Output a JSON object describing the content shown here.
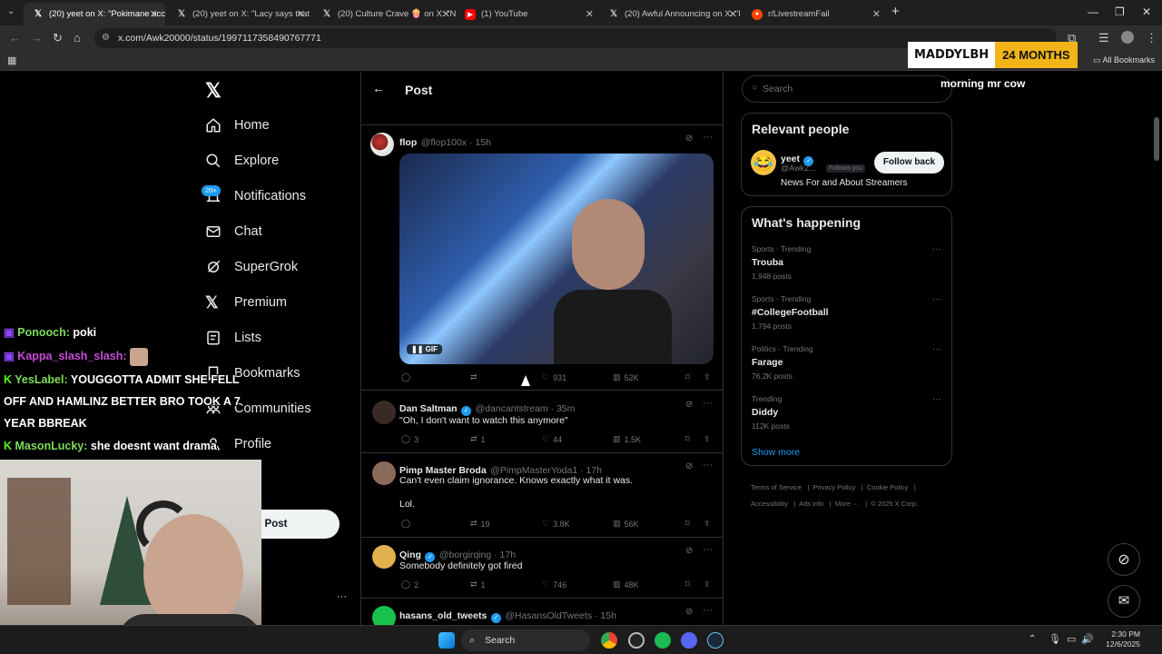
{
  "browser": {
    "tabs": [
      {
        "label": "(20) yeet on X: \"Pokimane acci",
        "icon": "x-logo"
      },
      {
        "label": "(20) yeet on X: \"Lacy says that I",
        "icon": "x-logo"
      },
      {
        "label": "(20) Culture Crave 🍿 on X: \"N",
        "icon": "x-logo"
      },
      {
        "label": "(1) YouTube",
        "icon": "youtube-icon"
      },
      {
        "label": "(20) Awful Announcing on X: \"I",
        "icon": "x-logo"
      },
      {
        "label": "r/LivestreamFail",
        "icon": "reddit-icon"
      }
    ],
    "url": "x.com/Awk20000/status/1997117358490767771",
    "all_bookmarks": "All Bookmarks"
  },
  "sub_badge": {
    "name": "MADDYLBH",
    "months": "24 MONTHS"
  },
  "stream_message": "morning mr cow",
  "nav": {
    "logo": "X",
    "notif_badge": "20+",
    "items": [
      "Home",
      "Explore",
      "Notifications",
      "Chat",
      "SuperGrok",
      "Premium",
      "Lists",
      "Bookmarks",
      "Communities",
      "Profile"
    ],
    "post_button": "Post"
  },
  "header": {
    "title": "Post"
  },
  "tweets": [
    {
      "name": "flop",
      "handle": "@flop100x · 15h",
      "gif_label": "GIF",
      "replies": "",
      "retweets": "",
      "likes": "931",
      "views": "52K"
    },
    {
      "name": "Dan Saltman",
      "handle": "@dancantstream · 35m",
      "text": "\"Oh, I don't want to watch this anymore\"",
      "replies": "3",
      "retweets": "1",
      "likes": "44",
      "views": "1.5K"
    },
    {
      "name": "Pimp Master Broda",
      "handle": "@PimpMasterYoda1 · 17h",
      "text": "Can't even claim ignorance. Knows exactly what it was.",
      "text2": "Lol.",
      "replies": "",
      "retweets": "19",
      "likes": "3.8K",
      "views": "56K"
    },
    {
      "name": "Qing",
      "handle": "@borgirqing · 17h",
      "text": "Somebody definitely got fired",
      "replies": "2",
      "retweets": "1",
      "likes": "746",
      "views": "48K"
    },
    {
      "name": "hasans_old_tweets",
      "handle": "@HasansOldTweets · 15h"
    }
  ],
  "search": {
    "placeholder": "Search"
  },
  "relevant": {
    "title": "Relevant people",
    "name": "yeet",
    "handle": "@Awk2...",
    "follows_you": "Follows you",
    "follow_back": "Follow back",
    "bio": "News For and About Streamers"
  },
  "happening": {
    "title": "What's happening",
    "trends": [
      {
        "category": "Sports · Trending",
        "name": "Trouba",
        "posts": "1,948 posts"
      },
      {
        "category": "Sports · Trending",
        "name": "#CollegeFootball",
        "posts": "1,794 posts"
      },
      {
        "category": "Politics · Trending",
        "name": "Farage",
        "posts": "76.2K posts"
      },
      {
        "category": "Trending",
        "name": "Diddy",
        "posts": "112K posts"
      }
    ],
    "show_more": "Show more"
  },
  "footer": {
    "terms": "Terms of Service",
    "privacy": "Privacy Policy",
    "cookie": "Cookie Policy",
    "accessibility": "Accessibility",
    "ads": "Ads info",
    "more": "More ···",
    "copyright": "© 2025 X Corp."
  },
  "chat": [
    {
      "user": "Ponooch:",
      "msg": "poki",
      "color": "#7ddc5a"
    },
    {
      "user": "Kappa_slash_slash:",
      "msg": "",
      "color": "#c84dd8"
    },
    {
      "user": "YesLabel:",
      "msg": "YOUGGOTTA ADMIT SHE FELL",
      "color": "#7ddc5a"
    },
    {
      "line": "OFF AND HAMLINZ BETTER BRO TOOK A 7"
    },
    {
      "line": "YEAR BBREAK"
    },
    {
      "user": "MasonLucky:",
      "msg": "she doesnt want drama",
      "color": "#7ddc5a"
    }
  ],
  "taskbar": {
    "search": "Search",
    "time": "2:30 PM",
    "date": "12/6/2025"
  }
}
